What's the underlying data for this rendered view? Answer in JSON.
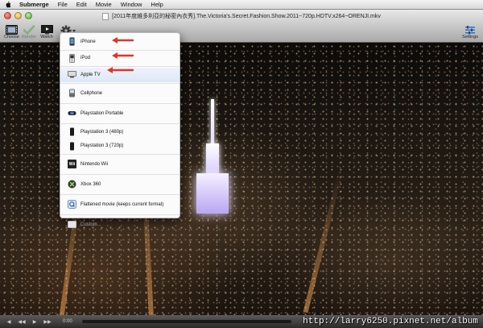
{
  "menubar": {
    "app": "Submerge",
    "items": [
      "File",
      "Edit",
      "Movie",
      "Window",
      "Help"
    ]
  },
  "window": {
    "title": "[2011年度維多利亞的秘密內衣秀].The.Victoria's.Secret.Fashion.Show.2011~720p.HDTV.x264~ORENJI.mkv"
  },
  "toolbar": {
    "choose": "Choose",
    "render": "Render",
    "watch": "Watch",
    "settings": "Settings"
  },
  "menu": {
    "items": [
      {
        "label": "iPhone",
        "icon": "iphone-icon"
      },
      {
        "label": "iPod",
        "icon": "ipod-icon"
      },
      {
        "label": "Apple TV",
        "icon": "appletv-icon"
      },
      {
        "label": "Cellphone",
        "icon": "cellphone-icon"
      },
      {
        "label": "Playstation Portable",
        "icon": "psp-icon"
      },
      {
        "label": "Playstation 3 (480p)",
        "icon": "ps3-icon"
      },
      {
        "label": "Playstation 3 (720p)",
        "icon": "ps3-icon"
      },
      {
        "label": "Nintendo Wii",
        "icon": "wii-icon"
      },
      {
        "label": "Xbox 360",
        "icon": "xbox-icon"
      },
      {
        "label": "Flattened movie (keeps current format)",
        "icon": "quicktime-icon"
      },
      {
        "label": "Custom...",
        "icon": "custom-icon"
      }
    ]
  },
  "controller": {
    "timecode": "0:00"
  },
  "watermark": "http://larry6250.pixnet.net/album",
  "colors": {
    "arrow": "#e0352b",
    "menu_bg": "#fbfbfb"
  }
}
